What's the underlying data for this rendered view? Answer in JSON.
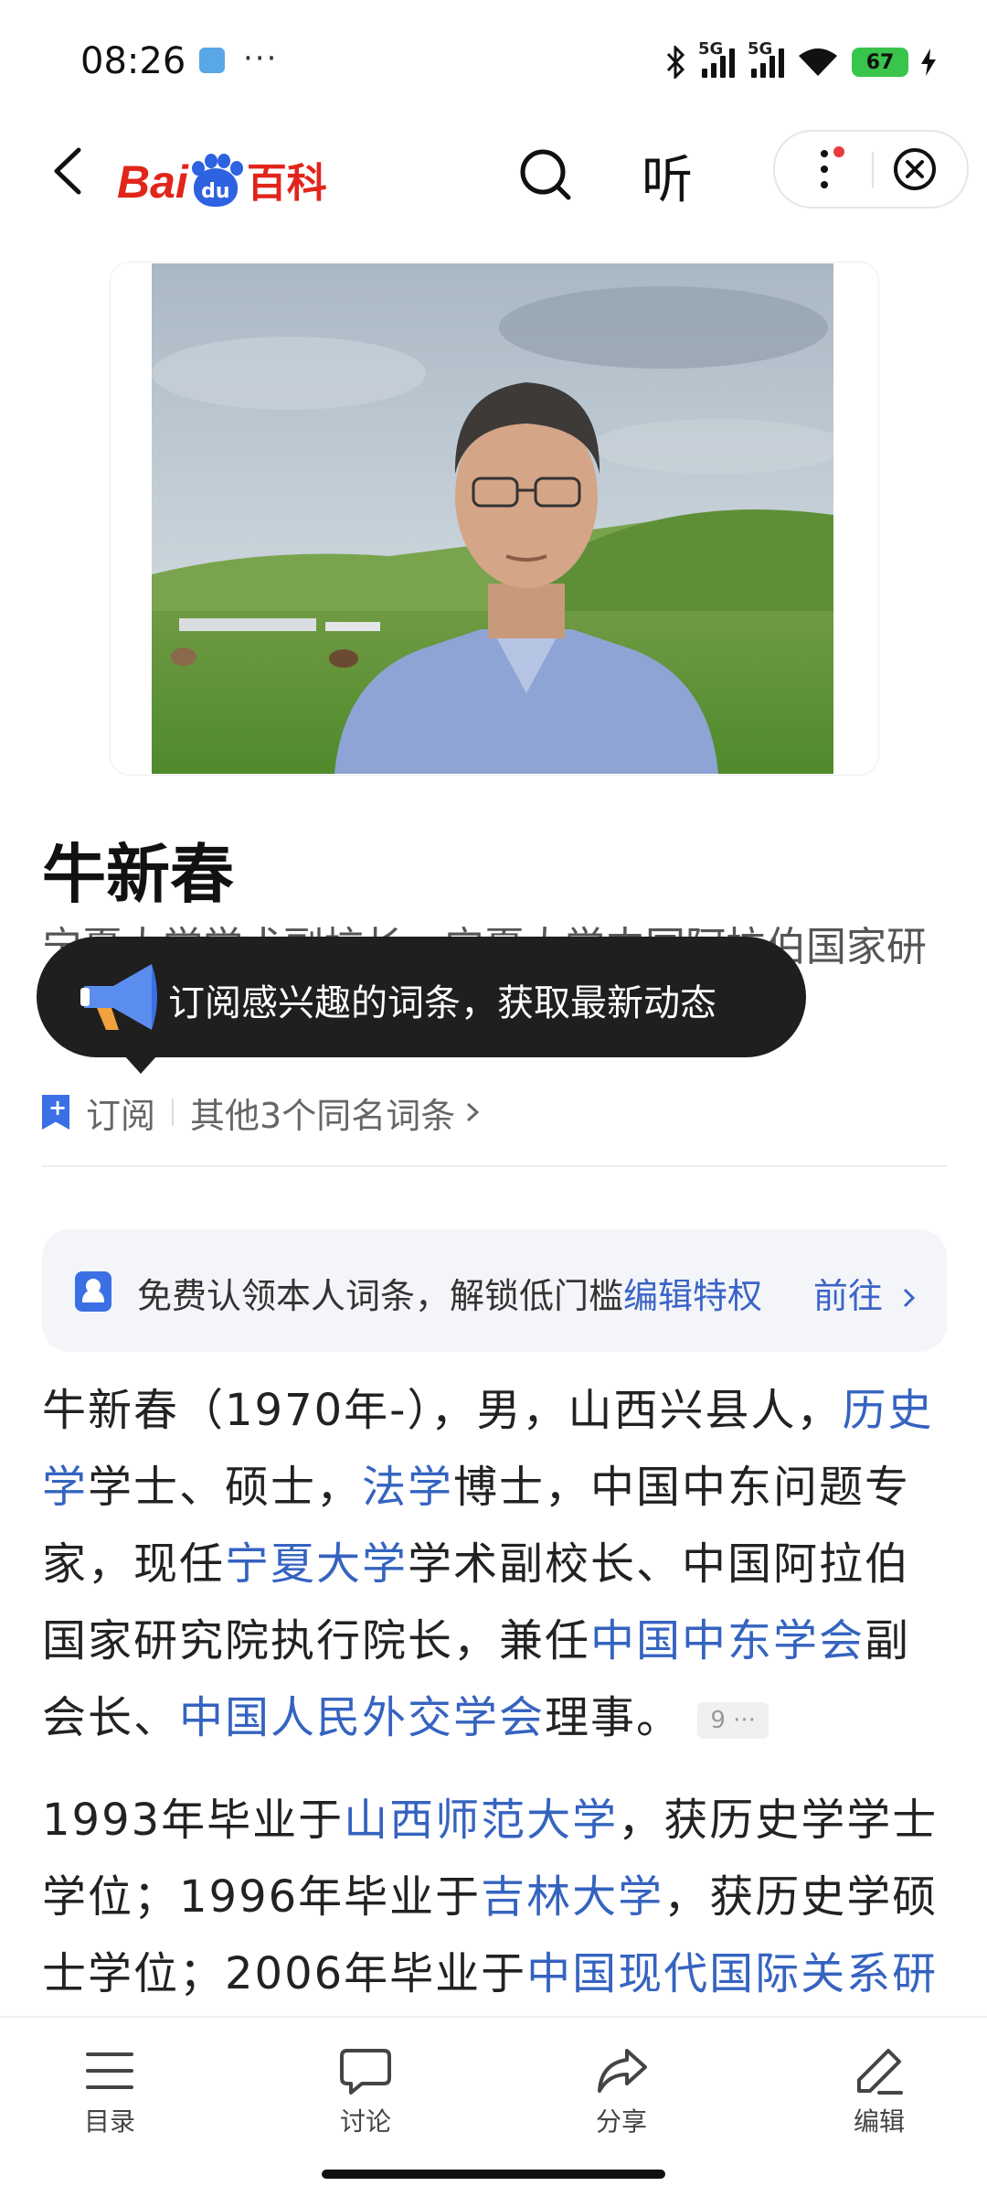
{
  "status_bar": {
    "time": "08:26",
    "dots": "···",
    "network_1": "5G",
    "network_2": "5G",
    "battery": "67",
    "icons": [
      "app-icon",
      "bluetooth-icon",
      "signal-icon",
      "signal-icon",
      "wifi-icon",
      "battery-icon",
      "charging-icon"
    ]
  },
  "header": {
    "logo_text_1": "Bai",
    "logo_text_2": "du",
    "logo_text_3": "百科",
    "listen_label": "听",
    "brand_red": "#e1251b",
    "brand_blue": "#2d62e0"
  },
  "entry": {
    "title": "牛新春",
    "subtitle": "宁夏大学学术副校长、宁夏大学中国阿拉伯国家研究院执行院长"
  },
  "tooltip": {
    "text": "订阅感兴趣的词条，获取最新动态"
  },
  "subscribe_row": {
    "subscribe_label": "订阅",
    "same_name_label": "其他3个同名词条"
  },
  "claim_card": {
    "text": "免费认领本人词条，解锁低门槛",
    "link": "编辑特权",
    "go_label": "前往"
  },
  "body": {
    "p1": [
      "牛新春（1970年-），男，山西兴县人，",
      "历史学",
      "学士、硕士，",
      "法学",
      "博士，中国中东问题专家，现任",
      "宁夏大学",
      "学术副校长、中国阿拉伯国家研究院执行院长，兼任",
      "中国中东学会",
      "副会长、",
      "中国人民外交学会",
      "理事。"
    ],
    "cite_label": "9",
    "cite_dots": "···",
    "p2": [
      "1993年毕业于",
      "山西师范大学",
      "，获历史学学士学位；1996年毕业于",
      "吉林大学",
      "，获历史学硕士学位；2006年毕业于",
      "中国现代国际关系研"
    ]
  },
  "bottom_bar": {
    "tabs": [
      {
        "label": "目录",
        "icon": "menu-icon"
      },
      {
        "label": "讨论",
        "icon": "chat-icon"
      },
      {
        "label": "分享",
        "icon": "share-icon"
      },
      {
        "label": "编辑",
        "icon": "pencil-icon"
      }
    ]
  }
}
